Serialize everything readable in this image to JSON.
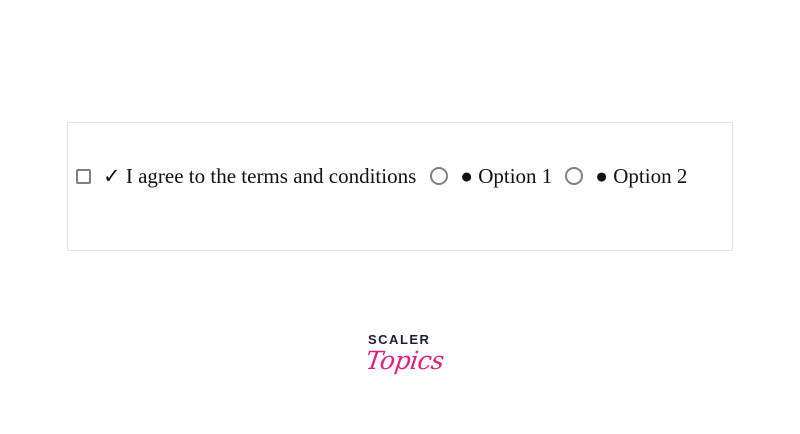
{
  "form": {
    "agree_label": "✓ I agree to the terms and conditions",
    "option1_label": "● Option 1",
    "option2_label": "● Option 2",
    "checkbox_checked": false,
    "radio1_selected": false,
    "radio2_selected": false
  },
  "brand": {
    "top": "SCALER",
    "bottom": "Topics",
    "accent_color": "#e0207a",
    "dark_color": "#1b1b3a"
  }
}
